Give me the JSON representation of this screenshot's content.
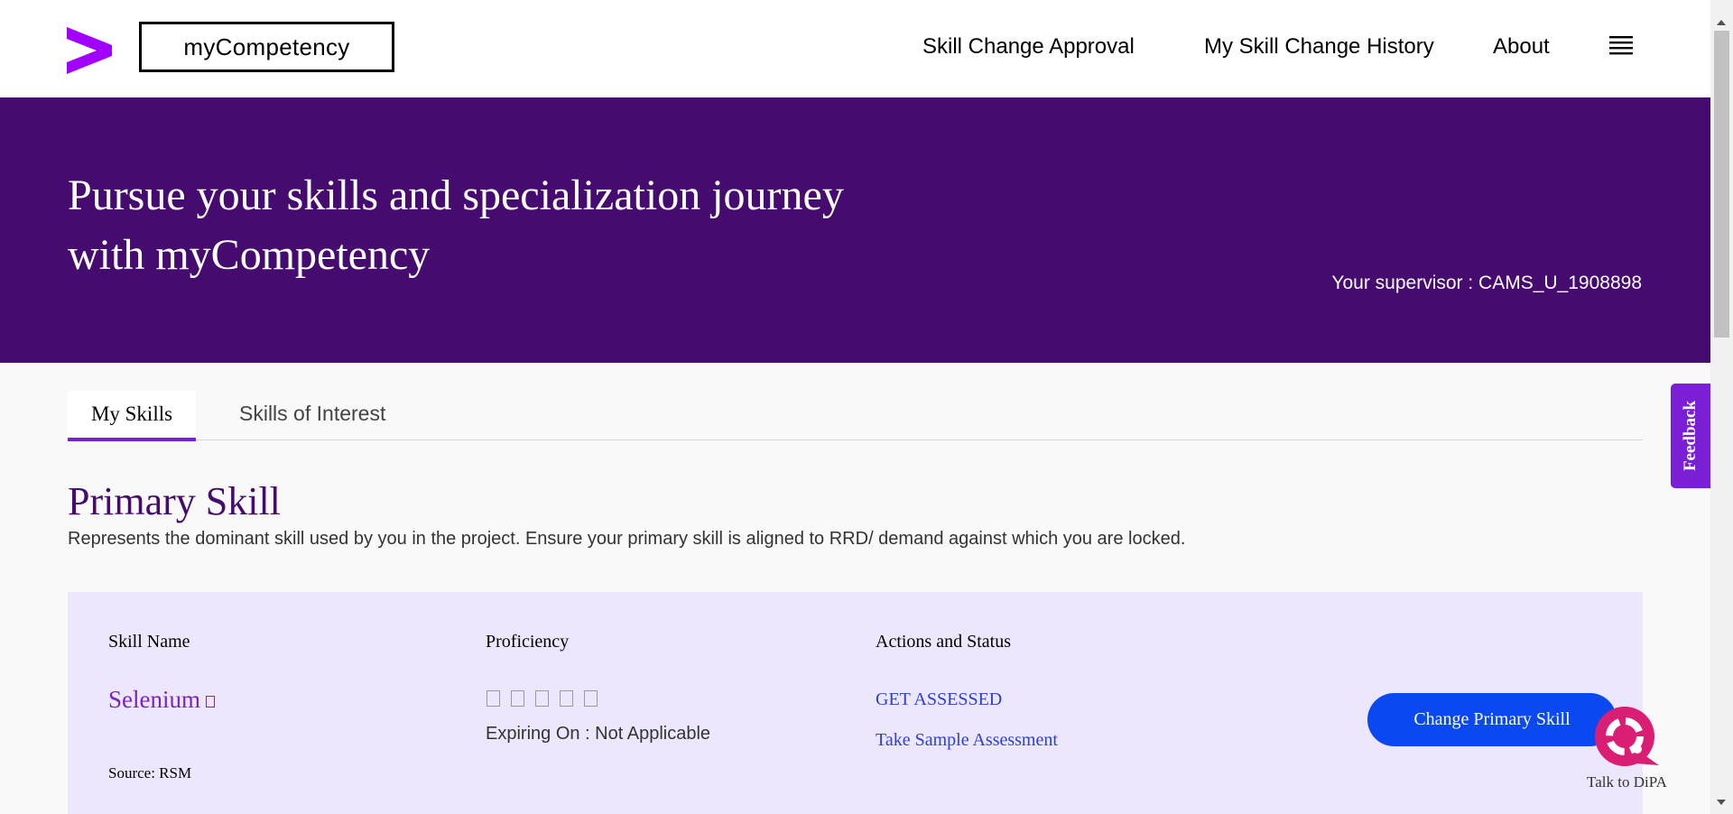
{
  "header": {
    "brand": "myCompetency",
    "nav": [
      {
        "label": "Skill Change Approval"
      },
      {
        "label": "My Skill Change History"
      },
      {
        "label": "About"
      }
    ]
  },
  "hero": {
    "title_line1": "Pursue your skills and specialization journey",
    "title_line2": "with myCompetency",
    "supervisor": "Your supervisor : CAMS_U_1908898"
  },
  "tabs": [
    {
      "label": "My Skills",
      "active": true
    },
    {
      "label": "Skills of Interest",
      "active": false
    }
  ],
  "primary_skill": {
    "title": "Primary Skill",
    "description": "Represents the dominant skill used by you in the project. Ensure your primary skill is aligned to RRD/ demand against which you are locked.",
    "columns": {
      "skill_name": "Skill Name",
      "proficiency": "Proficiency",
      "actions": "Actions and Status"
    },
    "skill": "Selenium",
    "source": "Source: RSM",
    "expiring": "Expiring On : Not Applicable",
    "get_assessed": "GET ASSESSED",
    "sample_assessment": "Take Sample Assessment",
    "change_button": "Change Primary Skill"
  },
  "widgets": {
    "feedback": "Feedback",
    "dipa": "Talk to DiPA"
  },
  "colors": {
    "brand_purple": "#460b6f",
    "accent_purple": "#7b1fd6",
    "card_bg": "#ece7fc",
    "button_blue": "#0a48f2",
    "link_blue": "#2b3fd6"
  }
}
